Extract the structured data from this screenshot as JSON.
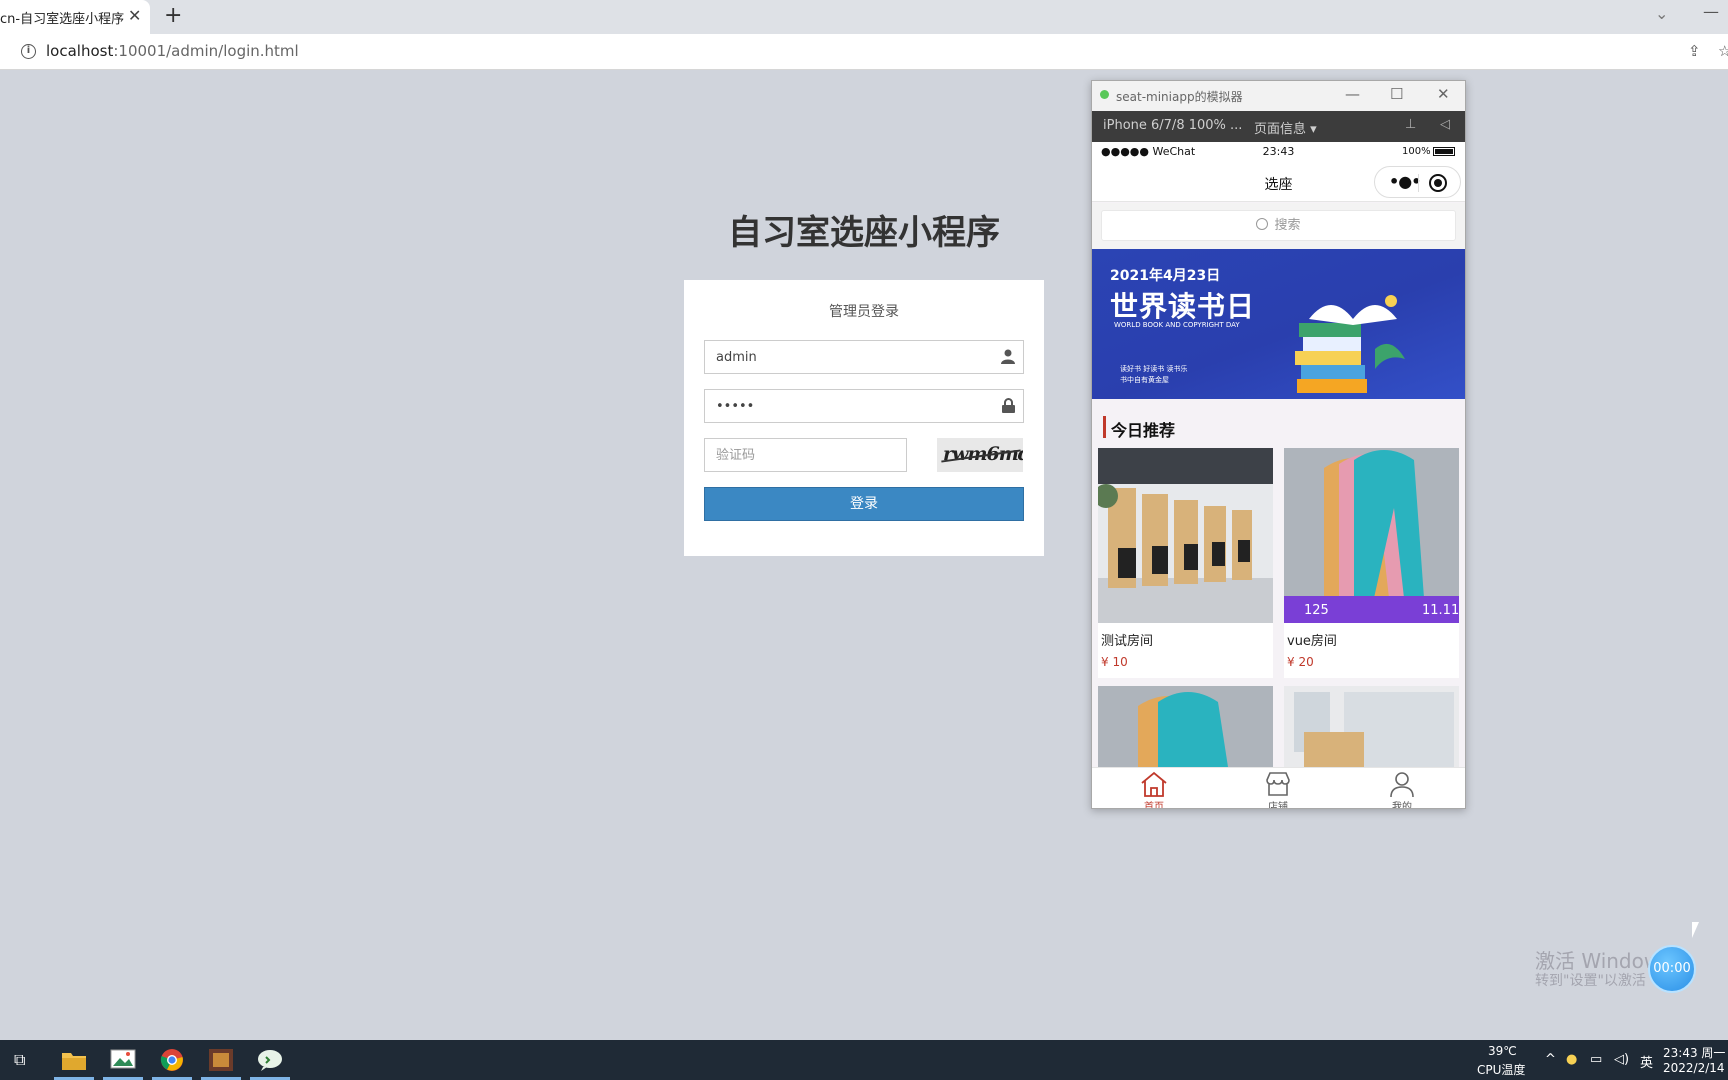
{
  "browser": {
    "tab_title": "cn-自习室选座小程序",
    "url_host": "localhost",
    "url_rest": ":10001/admin/login.html"
  },
  "login": {
    "heading": "自习室选座小程序",
    "subtitle": "管理员登录",
    "username_value": "admin",
    "password_value": "•••••",
    "captcha_placeholder": "验证码",
    "captcha_text": "rwm6md",
    "submit_label": "登录"
  },
  "simulator": {
    "title": "seat-miniapp的模拟器",
    "device": "iPhone 6/7/8 100% ...",
    "page_info": "页面信息 ▾",
    "status": {
      "carrier": "●●●●● WeChat",
      "time": "23:43",
      "battery": "100%"
    },
    "nav_title": "选座",
    "search_placeholder": "搜索",
    "banner": {
      "date": "2021年4月23日",
      "title": "世界读书日",
      "sub": "WORLD BOOK AND COPYRIGHT DAY",
      "line1": "读好书 好读书 读书乐",
      "line2": "书中自有黄金屋"
    },
    "section_title": "今日推荐",
    "cards": [
      {
        "name": "测试房间",
        "price": "¥ 10"
      },
      {
        "name": "vue房间",
        "price": "¥ 20"
      }
    ],
    "tabs": [
      {
        "label": "首页"
      },
      {
        "label": "店铺"
      },
      {
        "label": "我的"
      }
    ]
  },
  "overlay": {
    "watermark_line1": "激活 Window",
    "watermark_line2": "转到\"设置\"以激活",
    "timer": "00:00"
  },
  "taskbar": {
    "temp": "39℃",
    "temp_label": "CPU温度",
    "ime": "英",
    "time": "23:43 周一",
    "date": "2022/2/14"
  },
  "colors": {
    "login_button": "#3b88c3",
    "accent_red": "#c0392b",
    "banner_blue": "#2b44b4"
  }
}
